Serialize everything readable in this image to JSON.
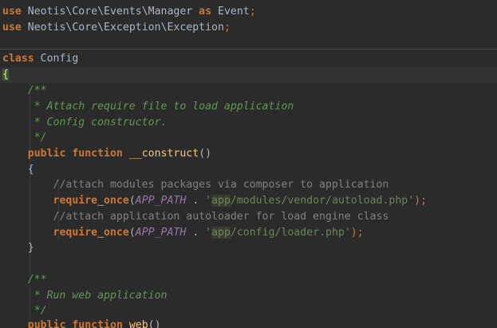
{
  "editor": {
    "line1": {
      "kw": "use",
      "ns": "Neotis\\Core\\Events\\Manager",
      "as": "as",
      "alias": "Event",
      "semi": ";"
    },
    "line2": {
      "kw": "use",
      "ns": "Neotis\\Core\\Exception\\Exception",
      "semi": ";"
    },
    "line3": {
      "kw": "class",
      "name": "Config"
    },
    "line4": {
      "brace": "{"
    },
    "line5": {
      "doc": "/**"
    },
    "line6": {
      "doc": " * Attach require file to load application"
    },
    "line7": {
      "doc": " * Config constructor."
    },
    "line8": {
      "doc": " */"
    },
    "line9": {
      "kw1": "public",
      "kw2": "function",
      "name": "__construct",
      "parens": "()"
    },
    "line10": {
      "brace": "{"
    },
    "line11": {
      "comment": "//attach modules packages via composer to application"
    },
    "line12": {
      "fn": "require_once",
      "open": "(",
      "const": "APP_PATH",
      "dot": " . ",
      "q": "'",
      "app": "app",
      "rest": "/modules/vendor/autoload.php'",
      "close": ");"
    },
    "line13": {
      "comment": "//attach application autoloader for load engine class"
    },
    "line14": {
      "fn": "require_once",
      "open": "(",
      "const": "APP_PATH",
      "dot": " . ",
      "q": "'",
      "app": "app",
      "rest": "/config/loader.php'",
      "close": ");"
    },
    "line15": {
      "brace": "}"
    },
    "line17": {
      "doc": "/**"
    },
    "line18": {
      "doc": " * Run web application"
    },
    "line19": {
      "doc": " */"
    },
    "line20": {
      "kw1": "public",
      "kw2": "function",
      "name": "web",
      "parens": "()"
    }
  },
  "colors": {
    "background": "#2b2b2b",
    "keyword": "#cc7832",
    "docComment": "#629755",
    "lineComment": "#808080",
    "string": "#6a8759",
    "constant": "#9876aa",
    "function": "#ffc66d",
    "text": "#a9b7c6"
  }
}
